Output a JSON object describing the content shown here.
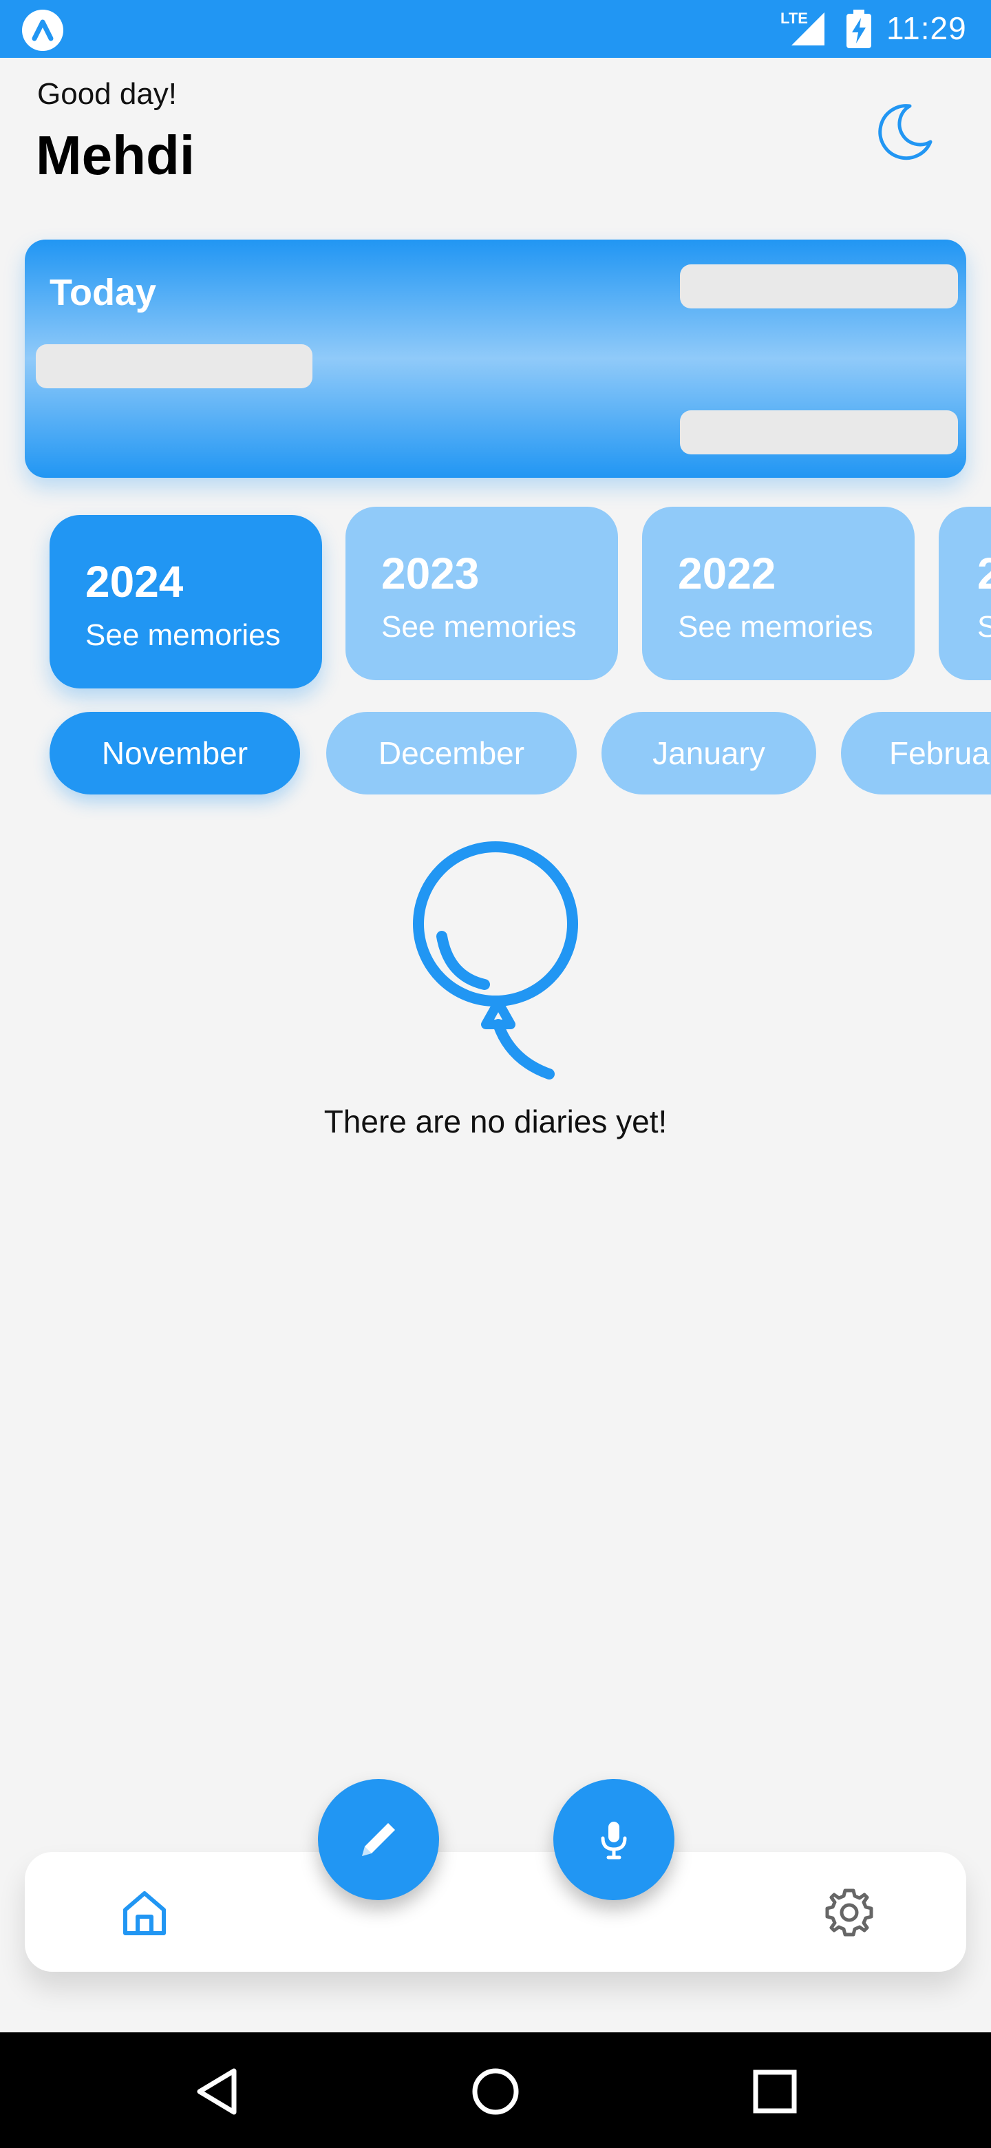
{
  "status_bar": {
    "time": "11:29",
    "network": "LTE"
  },
  "header": {
    "greeting": "Good day!",
    "user_name": "Mehdi"
  },
  "today_card": {
    "title": "Today"
  },
  "years": [
    {
      "year": "2024",
      "label": "See memories",
      "selected": true
    },
    {
      "year": "2023",
      "label": "See memories",
      "selected": false
    },
    {
      "year": "2022",
      "label": "See memories",
      "selected": false
    },
    {
      "year": "2",
      "label": "S",
      "selected": false
    }
  ],
  "months": [
    {
      "label": "November",
      "selected": true
    },
    {
      "label": "December",
      "selected": false
    },
    {
      "label": "January",
      "selected": false
    },
    {
      "label": "Februa",
      "selected": false
    }
  ],
  "empty_state": {
    "message": "There are no diaries yet!",
    "icon": "balloon-icon"
  },
  "bottom_nav": {
    "items": [
      "home-icon",
      "settings-icon"
    ],
    "fabs": [
      "pencil-icon",
      "microphone-icon"
    ]
  },
  "colors": {
    "accent": "#2196f3",
    "accent_light": "#90caf9",
    "background": "#f4f4f4",
    "skeleton": "#e9e9e9"
  }
}
